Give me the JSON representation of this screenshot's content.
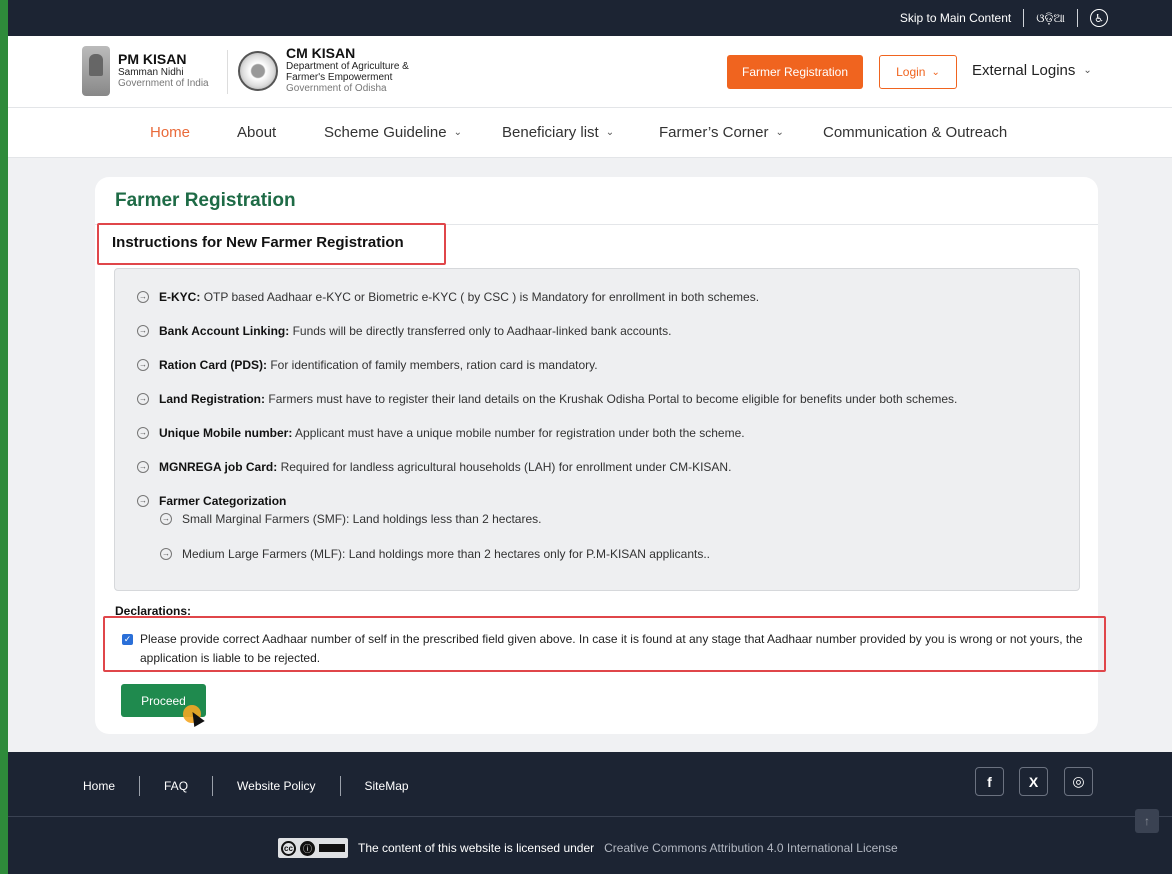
{
  "topbar": {
    "skip_link": "Skip to Main Content",
    "language": "ଓଡ଼ିଆ",
    "accessibility_glyph": "♿"
  },
  "header": {
    "pm_kisan": {
      "title": "PM KISAN",
      "sub": "Samman Nidhi",
      "gov": "Government of India"
    },
    "cm_kisan": {
      "title": "CM KISAN",
      "dept1": "Department of Agriculture &",
      "dept2": "Farmer's Empowerment",
      "gov": "Government of Odisha"
    },
    "register_button": "Farmer Registration",
    "login_button": "Login",
    "external_logins": "External Logins"
  },
  "nav": {
    "items": [
      {
        "label": "Home",
        "active": true,
        "dropdown": false
      },
      {
        "label": "About",
        "active": false,
        "dropdown": false
      },
      {
        "label": "Scheme Guideline",
        "active": false,
        "dropdown": true
      },
      {
        "label": "Beneficiary list",
        "active": false,
        "dropdown": true
      },
      {
        "label": "Farmer’s Corner",
        "active": false,
        "dropdown": true
      },
      {
        "label": "Communication & Outreach",
        "active": false,
        "dropdown": false
      }
    ],
    "chevron": "⌄"
  },
  "main": {
    "title": "Farmer Registration",
    "instructions_title": "Instructions for New Farmer Registration",
    "instructions": [
      {
        "term": "E-KYC:",
        "text": "OTP based Aadhaar e-KYC or Biometric e-KYC ( by CSC ) is Mandatory for enrollment in both schemes."
      },
      {
        "term": "Bank Account Linking:",
        "text": "Funds will be directly transferred only to Aadhaar-linked bank accounts."
      },
      {
        "term": "Ration Card (PDS):",
        "text": "For identification of family members, ration card is mandatory."
      },
      {
        "term": "Land Registration:",
        "text": "Farmers must have to register their land details on the Krushak Odisha Portal to become eligible for benefits under both schemes."
      },
      {
        "term": "Unique Mobile number:",
        "text": "Applicant must have a unique mobile number for registration under both the scheme."
      },
      {
        "term": "MGNREGA job Card:",
        "text": "Required for landless agricultural households (LAH) for enrollment under CM-KISAN."
      },
      {
        "term": "Farmer Categorization",
        "text": ""
      }
    ],
    "categories": [
      "Small Marginal Farmers (SMF): Land holdings less than 2 hectares.",
      "Medium Large Farmers (MLF): Land holdings more than 2 hectares only for P.M-KISAN applicants.."
    ],
    "bullet_glyph": "→",
    "declarations_label": "Declarations:",
    "declaration_checked": true,
    "declaration_text": "Please provide correct Aadhaar number of self in the prescribed field given above. In case it is found at any stage that Aadhaar number provided by you is wrong or not yours, the application is liable to be rejected.",
    "proceed_button": "Proceed"
  },
  "footer": {
    "links": [
      "Home",
      "FAQ",
      "Website Policy",
      "SiteMap"
    ],
    "social": [
      {
        "name": "facebook",
        "glyph": "f"
      },
      {
        "name": "x",
        "glyph": "X"
      },
      {
        "name": "instagram",
        "glyph": "◎"
      }
    ],
    "scroll_top_glyph": "↑",
    "license_text": "The content of this website is licensed under",
    "license_link": "Creative Commons Attribution 4.0 International License"
  },
  "colors": {
    "primary_orange": "#f0641f",
    "green_title": "#1e6b46",
    "proceed_green": "#1f8a4e",
    "highlight_red": "#e0464a",
    "dark_bar": "#1c2433"
  }
}
